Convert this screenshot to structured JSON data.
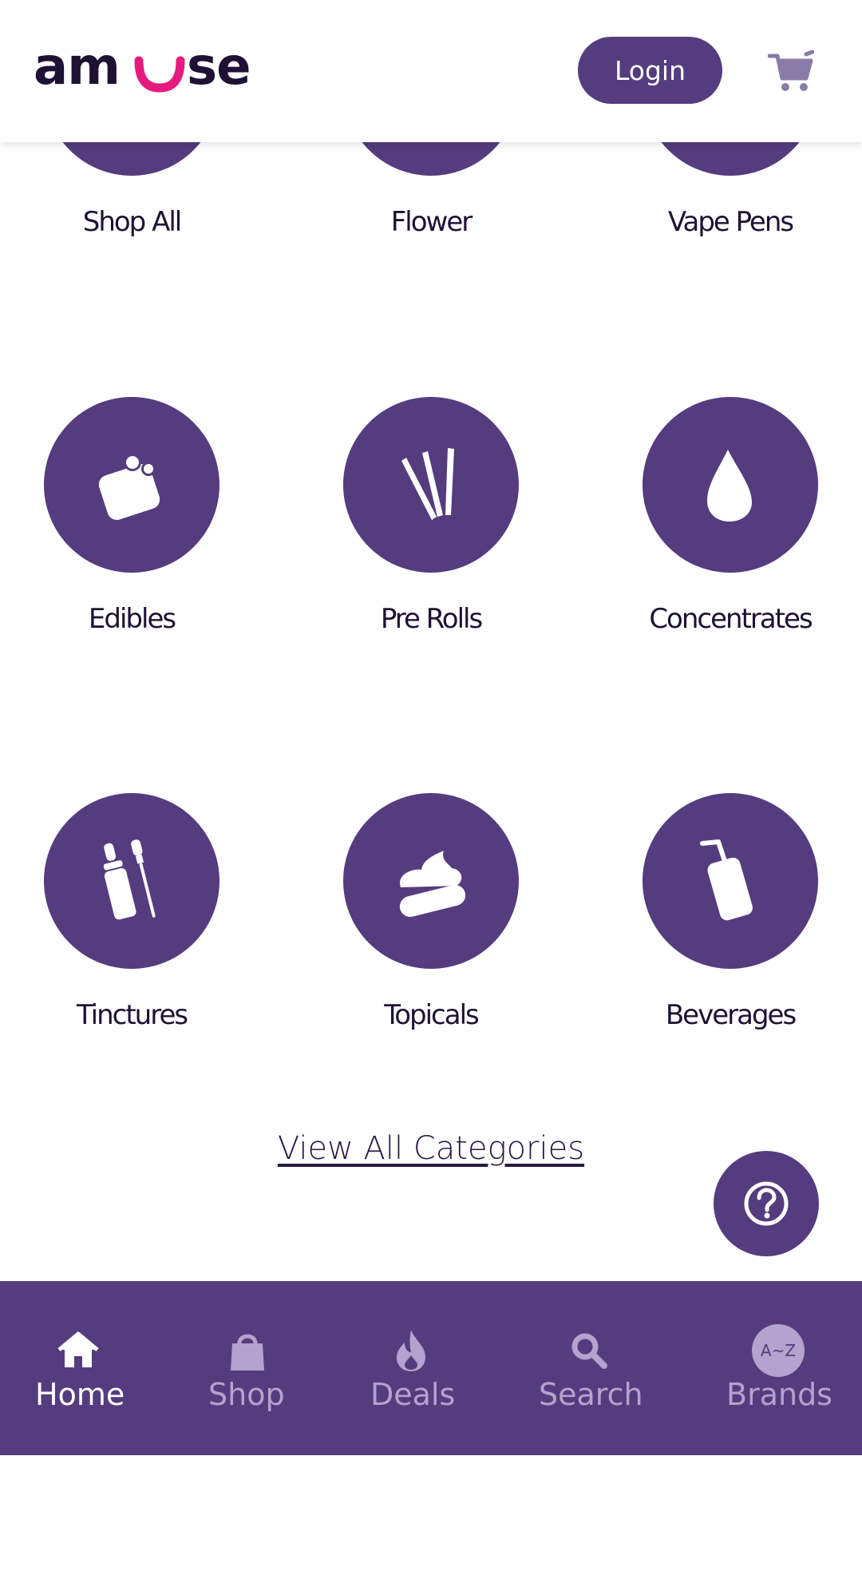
{
  "colors": {
    "brand_purple": "#553c7e",
    "accent_pink": "#e6197e",
    "dark_text": "#1f1133",
    "nav_inactive": "#b3a3ce"
  },
  "header": {
    "logo_text": "amuse",
    "login_label": "Login",
    "cart_icon": "cart-icon"
  },
  "categories": [
    {
      "label": "Shop All",
      "icon": "shop-all-icon"
    },
    {
      "label": "Flower",
      "icon": "flower-icon"
    },
    {
      "label": "Vape Pens",
      "icon": "vape-pen-icon"
    },
    {
      "label": "Edibles",
      "icon": "edible-gummy-icon"
    },
    {
      "label": "Pre Rolls",
      "icon": "pre-roll-icon"
    },
    {
      "label": "Concentrates",
      "icon": "droplet-icon"
    },
    {
      "label": "Tinctures",
      "icon": "tincture-dropper-icon"
    },
    {
      "label": "Topicals",
      "icon": "cream-icon"
    },
    {
      "label": "Beverages",
      "icon": "can-with-straw-icon"
    }
  ],
  "view_all_label": "View All Categories",
  "help_icon": "question-mark-icon",
  "nav": [
    {
      "label": "Home",
      "icon": "home-icon",
      "active": true
    },
    {
      "label": "Shop",
      "icon": "shopping-bag-icon",
      "active": false
    },
    {
      "label": "Deals",
      "icon": "flame-icon",
      "active": false
    },
    {
      "label": "Search",
      "icon": "search-icon",
      "active": false
    },
    {
      "label": "Brands",
      "icon": "a-z-icon",
      "active": false,
      "badge": "A~Z"
    }
  ]
}
